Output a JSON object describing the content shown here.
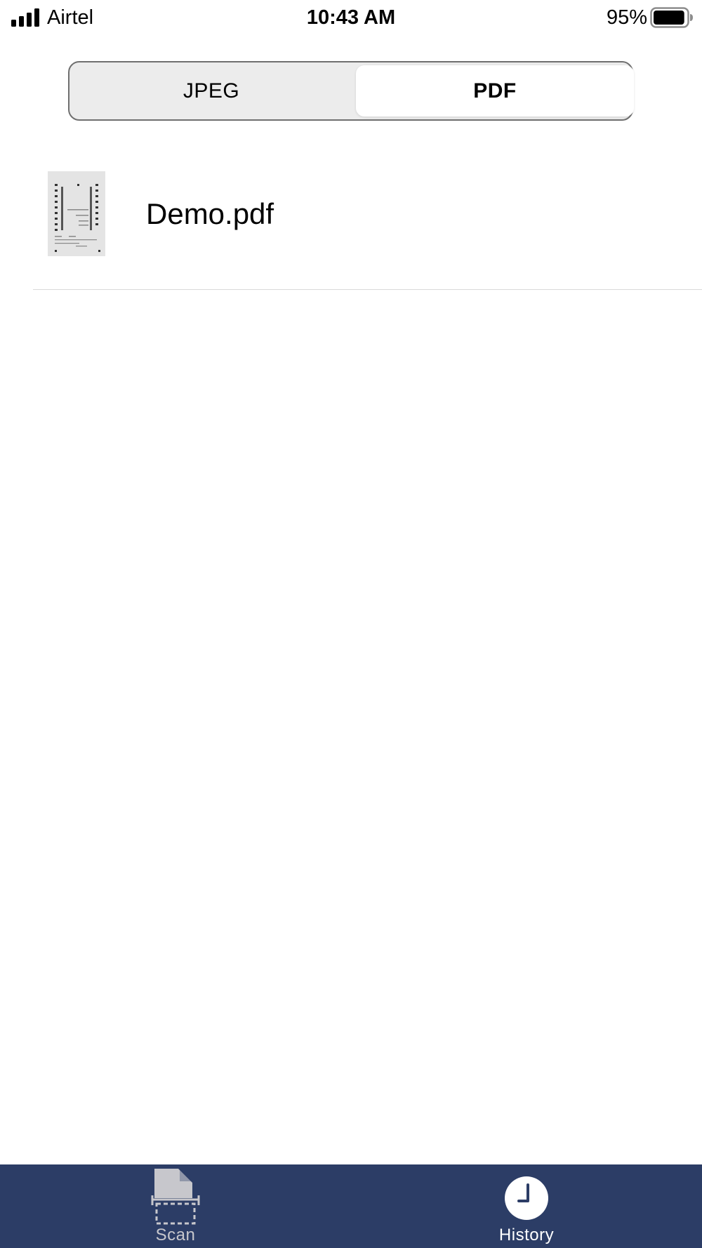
{
  "status_bar": {
    "carrier": "Airtel",
    "time": "10:43 AM",
    "battery_percent": "95%",
    "signal_bars": 4,
    "battery_level": 0.95
  },
  "segmented_control": {
    "options": [
      "JPEG",
      "PDF"
    ],
    "selected": "PDF"
  },
  "files": [
    {
      "name": "Demo.pdf",
      "thumbnail_icon": "document-thumbnail"
    }
  ],
  "tab_bar": {
    "background_color": "#2c3d66",
    "items": [
      {
        "label": "Scan",
        "icon": "scan-document-icon",
        "active": false
      },
      {
        "label": "History",
        "icon": "clock-icon",
        "active": true
      }
    ]
  }
}
